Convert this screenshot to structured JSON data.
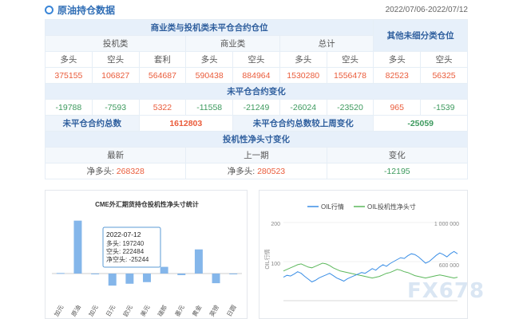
{
  "header": {
    "title": "原油持仓数据",
    "date_range": "2022/07/06-2022/07/12"
  },
  "table": {
    "title_left": "商业类与投机类未平仓合约仓位",
    "title_right": "其他未细分类仓位",
    "group_spec": "投机类",
    "group_comm": "商业类",
    "group_total": "总计",
    "col_long": "多头",
    "col_short": "空头",
    "col_arb": "套利",
    "values": [
      "375155",
      "106827",
      "564687",
      "590438",
      "884964",
      "1530280",
      "1556478",
      "82523",
      "56325"
    ],
    "change_title": "未平仓合约变化",
    "changes": [
      "-19788",
      "-7593",
      "5322",
      "-11558",
      "-21249",
      "-26024",
      "-23520",
      "965",
      "-1539"
    ],
    "oi_total_label": "未平仓合约总数",
    "oi_total_value": "1612803",
    "oi_change_label": "未平仓合约总数较上周变化",
    "oi_change_value": "-25059",
    "net_title": "投机性净头寸变化",
    "net_latest_label": "最新",
    "net_prev_label": "上一期",
    "net_change_label": "变化",
    "net_prefix": "净多头:",
    "net_latest_value": "268328",
    "net_prev_value": "280523",
    "net_change_value": "-12195"
  },
  "chart_data": [
    {
      "type": "bar",
      "title": "CME外汇期货持仓投机性净头寸统计",
      "categories": [
        "加元",
        "原油",
        "加元",
        "日元",
        "欧元",
        "美元",
        "瑞郎",
        "墨元",
        "黄金",
        "英镑",
        "日圆"
      ],
      "values": [
        2000,
        197240,
        -1500,
        -45000,
        -38000,
        -32000,
        25000,
        -6000,
        90000,
        -36000,
        0
      ],
      "tooltip": {
        "date": "2022-07-12",
        "long_label": "多头:",
        "long_value": "197240",
        "short_label": "空头:",
        "short_value": "222484",
        "net_label": "净空头:",
        "net_value": "-25244"
      },
      "colors": {
        "bar": "#84b6ea",
        "tooltip_border": "#5b9bd5"
      }
    },
    {
      "type": "line",
      "legend": [
        "OIL行情",
        "OIL投机性净头寸"
      ],
      "ylabel": "OIL行情",
      "left_ticks": [
        "200",
        "100"
      ],
      "right_ticks": [
        "1 000 000",
        "600 000"
      ],
      "ylim_left": [
        0,
        200
      ],
      "ylim_right": [
        0,
        1000000
      ],
      "series": [
        {
          "name": "OIL行情",
          "color": "#3a8ee6",
          "values": [
            60,
            65,
            63,
            68,
            74,
            70,
            62,
            55,
            48,
            52,
            58,
            62,
            66,
            70,
            64,
            58,
            54,
            50,
            56,
            60,
            64,
            68,
            72,
            70,
            76,
            82,
            78,
            86,
            92,
            88,
            95,
            100,
            105,
            110,
            108,
            115,
            120,
            118,
            112,
            104,
            96,
            100,
            108,
            116,
            122,
            118,
            112,
            120,
            126,
            120
          ]
        },
        {
          "name": "OIL投机性净头寸",
          "color": "#5cb85c",
          "values": [
            380000,
            400000,
            420000,
            440000,
            460000,
            470000,
            450000,
            430000,
            420000,
            440000,
            460000,
            480000,
            470000,
            450000,
            420000,
            400000,
            380000,
            370000,
            360000,
            350000,
            340000,
            330000,
            320000,
            310000,
            300000,
            290000,
            300000,
            310000,
            330000,
            350000,
            360000,
            380000,
            400000,
            390000,
            370000,
            360000,
            340000,
            320000,
            310000,
            300000,
            290000,
            300000,
            310000,
            320000,
            330000,
            320000,
            310000,
            300000,
            290000,
            300000
          ]
        }
      ]
    }
  ],
  "watermark": "FX678"
}
